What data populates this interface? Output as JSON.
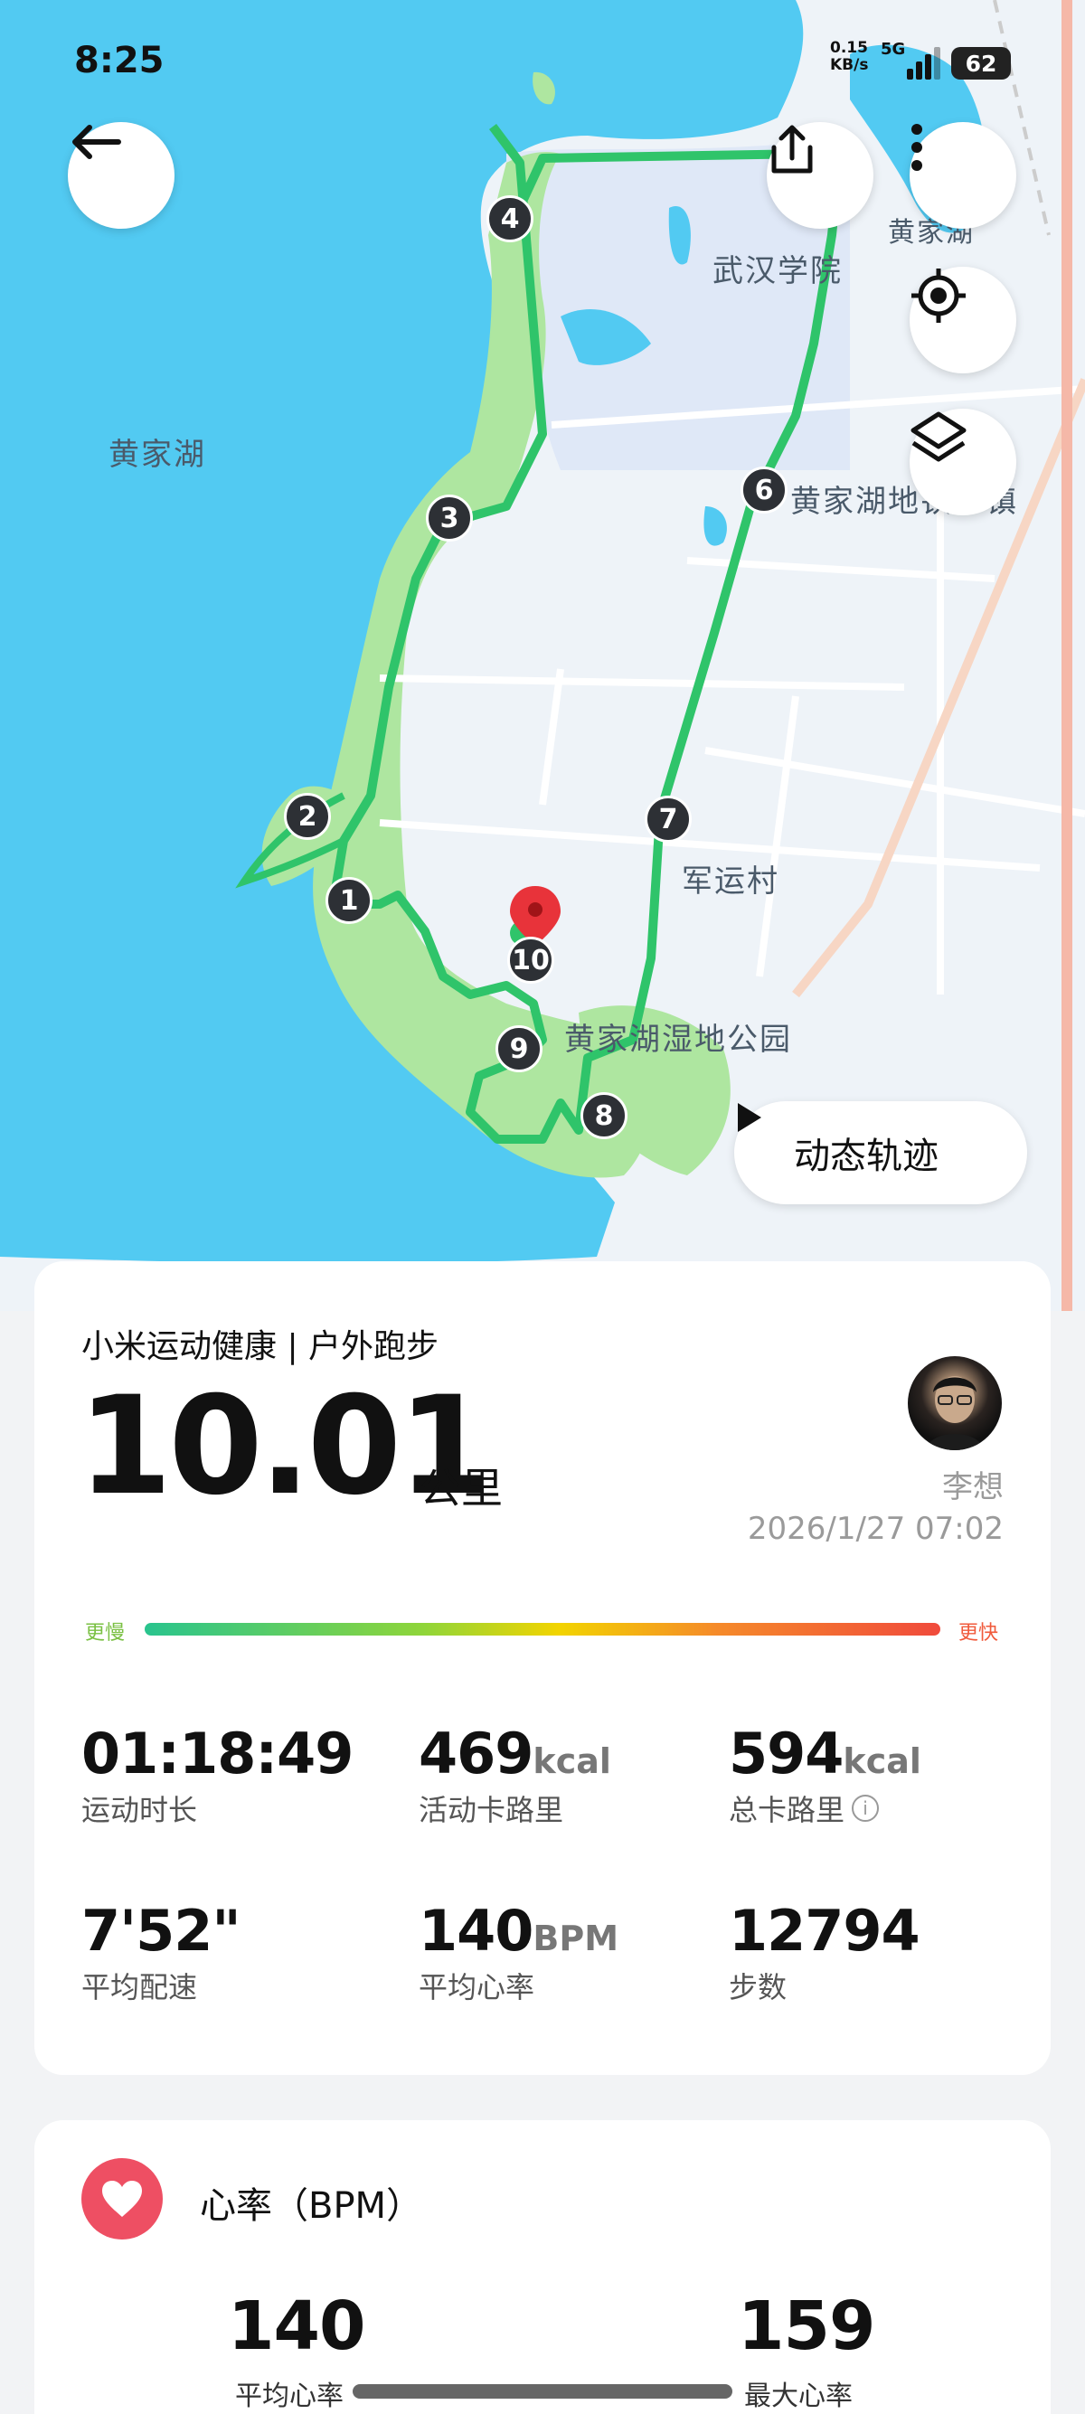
{
  "status_bar": {
    "time": "8:25",
    "net_speed": "0.15\nKB/s",
    "network": "5G",
    "battery": "62"
  },
  "map": {
    "labels": [
      "武汉学院",
      "黄家湖",
      "黄家湖地铁小镇",
      "军运村",
      "黄家湖湿地公园",
      "黄家湖"
    ],
    "markers": [
      "1",
      "2",
      "3",
      "4",
      "6",
      "7",
      "8",
      "9",
      "10"
    ],
    "route_color": "#2fc46a",
    "dynamic_track_label": "动态轨迹"
  },
  "summary": {
    "app_title": "小米运动健康 | 户外跑步",
    "distance": "10.01",
    "distance_unit": "公里",
    "user": "李想",
    "datetime": "2026/1/27 07:02",
    "pace_slow": "更慢",
    "pace_fast": "更快",
    "stats": [
      {
        "value": "01:18:49",
        "unit": "",
        "label": "运动时长"
      },
      {
        "value": "469",
        "unit": "kcal",
        "label": "活动卡路里"
      },
      {
        "value": "594",
        "unit": "kcal",
        "label": "总卡路里"
      },
      {
        "value": "7'52\"",
        "unit": "",
        "label": "平均配速"
      },
      {
        "value": "140",
        "unit": "BPM",
        "label": "平均心率"
      },
      {
        "value": "12794",
        "unit": "",
        "label": "步数"
      }
    ]
  },
  "heart_rate": {
    "title": "心率（BPM）",
    "avg_value": "140",
    "avg_label": "平均心率",
    "max_value": "159",
    "max_label": "最大心率"
  },
  "colors": {
    "water": "#52caf2",
    "land": "#eef3f8",
    "park": "#aee6a0",
    "route": "#2fc46a",
    "heart": "#ee4f63"
  }
}
